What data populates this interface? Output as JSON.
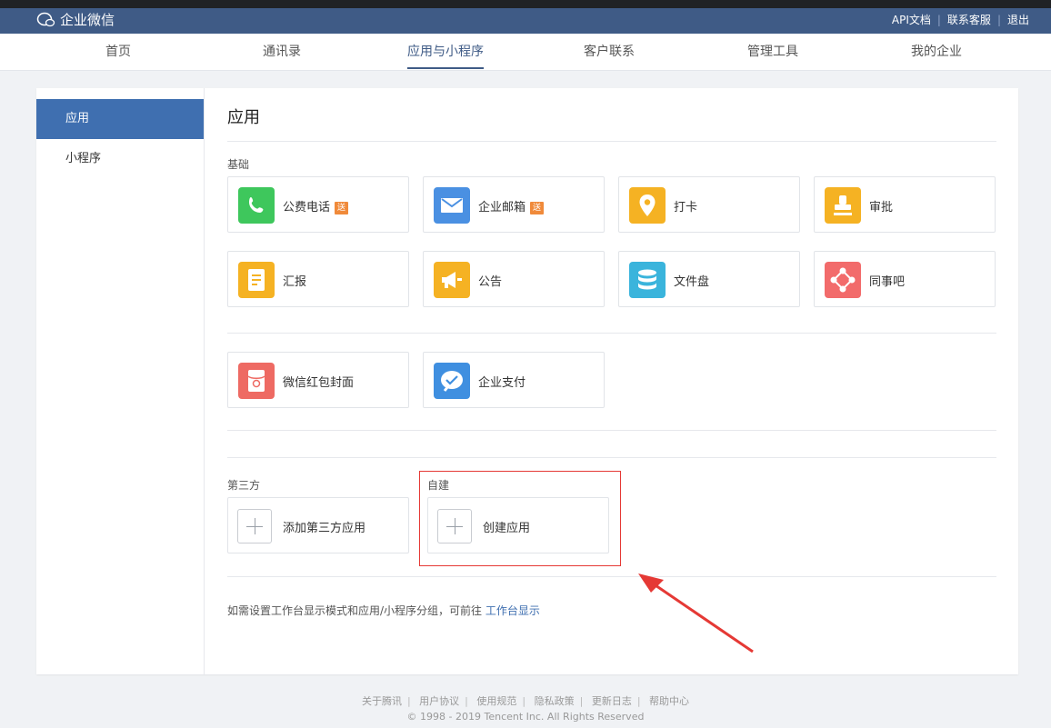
{
  "header": {
    "logo_text": "企业微信",
    "links": [
      "API文档",
      "联系客服",
      "退出"
    ]
  },
  "nav": {
    "items": [
      "首页",
      "通讯录",
      "应用与小程序",
      "客户联系",
      "管理工具",
      "我的企业"
    ],
    "active_index": 2
  },
  "sidebar": {
    "items": [
      "应用",
      "小程序"
    ],
    "active_index": 0
  },
  "main": {
    "title": "应用",
    "basic_label": "基础",
    "send_badge": "送",
    "basic_apps": [
      {
        "name": "公费电话",
        "badge": true,
        "icon": "phone-icon",
        "color": "#3ec75c"
      },
      {
        "name": "企业邮箱",
        "badge": true,
        "icon": "mail-icon",
        "color": "#4a90e2"
      },
      {
        "name": "打卡",
        "badge": false,
        "icon": "location-pin-icon",
        "color": "#f5b223"
      },
      {
        "name": "审批",
        "badge": false,
        "icon": "stamp-icon",
        "color": "#f5b223"
      },
      {
        "name": "汇报",
        "badge": false,
        "icon": "report-doc-icon",
        "color": "#f5b223"
      },
      {
        "name": "公告",
        "badge": false,
        "icon": "megaphone-icon",
        "color": "#f5b223"
      },
      {
        "name": "文件盘",
        "badge": false,
        "icon": "database-icon",
        "color": "#3ab4dc"
      },
      {
        "name": "同事吧",
        "badge": false,
        "icon": "colleague-network-icon",
        "color": "#f26b6b"
      }
    ],
    "extra_apps": [
      {
        "name": "微信红包封面",
        "icon": "red-packet-icon",
        "color": "#ee6a63"
      },
      {
        "name": "企业支付",
        "icon": "payment-icon",
        "color": "#3f8fe0"
      }
    ],
    "third_party_label": "第三方",
    "third_party_add": "添加第三方应用",
    "custom_label": "自建",
    "custom_add": "创建应用",
    "hint_text": "如需设置工作台显示模式和应用/小程序分组，可前往",
    "hint_link": "工作台显示",
    "accent_color": "#3f6fb0",
    "highlight_color": "#e53935"
  },
  "footer": {
    "links": [
      "关于腾讯",
      "用户协议",
      "使用规范",
      "隐私政策",
      "更新日志",
      "帮助中心"
    ],
    "copyright": "© 1998 - 2019 Tencent Inc. All Rights Reserved"
  }
}
